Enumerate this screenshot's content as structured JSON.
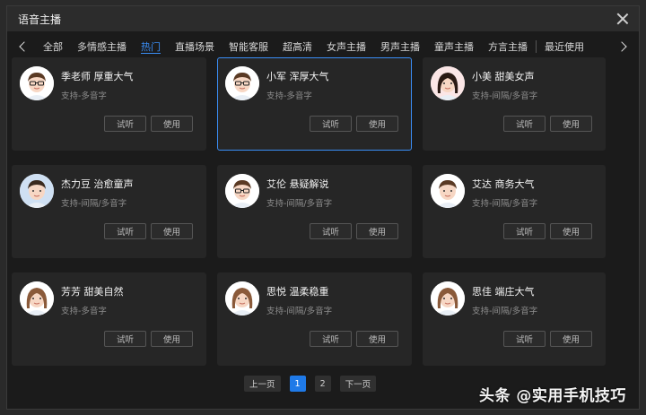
{
  "dialog": {
    "title": "语音主播"
  },
  "tabs": [
    {
      "label": "全部",
      "active": false
    },
    {
      "label": "多情感主播",
      "active": false
    },
    {
      "label": "热门",
      "active": true
    },
    {
      "label": "直播场景",
      "active": false
    },
    {
      "label": "智能客服",
      "active": false
    },
    {
      "label": "超高清",
      "active": false
    },
    {
      "label": "女声主播",
      "active": false
    },
    {
      "label": "男声主播",
      "active": false
    },
    {
      "label": "童声主播",
      "active": false
    },
    {
      "label": "方言主播",
      "active": false
    },
    {
      "label": "最近使用",
      "active": false
    }
  ],
  "cards": [
    {
      "name": "季老师 厚重大气",
      "support": "支持-多音字",
      "avatar": "man-glasses-icon"
    },
    {
      "name": "小军 浑厚大气",
      "support": "支持-多音字",
      "avatar": "man-glasses-icon"
    },
    {
      "name": "小美 甜美女声",
      "support": "支持-间隔/多音字",
      "avatar": "woman-long-hair-icon"
    },
    {
      "name": "杰力豆 治愈童声",
      "support": "支持-间隔/多音字",
      "avatar": "child-icon"
    },
    {
      "name": "艾伦 悬疑解说",
      "support": "支持-间隔/多音字",
      "avatar": "man-glasses-icon"
    },
    {
      "name": "艾达 商务大气",
      "support": "支持-间隔/多音字",
      "avatar": "man-icon"
    },
    {
      "name": "芳芳 甜美自然",
      "support": "支持-多音字",
      "avatar": "woman-icon"
    },
    {
      "name": "思悦 温柔稳重",
      "support": "支持-间隔/多音字",
      "avatar": "woman-icon"
    },
    {
      "name": "思佳 端庄大气",
      "support": "支持-间隔/多音字",
      "avatar": "woman-icon"
    }
  ],
  "card_buttons": {
    "preview": "试听",
    "use": "使用"
  },
  "pagination": {
    "prev": "上一页",
    "pages": [
      "1",
      "2"
    ],
    "current": "1",
    "next": "下一页"
  },
  "watermark": "头条 @实用手机技巧",
  "colors": {
    "accent": "#3a8df5",
    "page_active": "#1f7ae8"
  }
}
